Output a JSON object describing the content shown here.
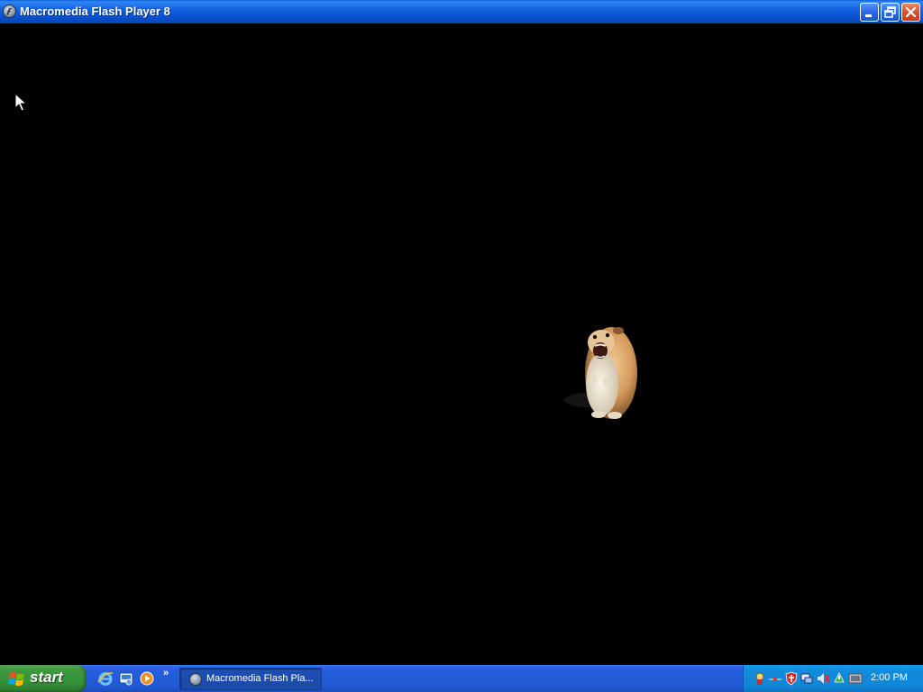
{
  "window": {
    "title": "Macromedia Flash Player 8",
    "icon": "flash-player-icon",
    "controls": [
      "minimize-icon",
      "restore-icon",
      "close-icon"
    ]
  },
  "stage": {
    "background": "#000000",
    "content": "hamster-image"
  },
  "taskbar": {
    "start_label": "start",
    "quick_launch": [
      "internet-explorer-icon",
      "show-desktop-icon",
      "media-player-icon"
    ],
    "more_label": "»",
    "tasks": [
      {
        "label": "Macromedia Flash Pla...",
        "icon": "flash-player-icon"
      }
    ],
    "tray_icons": [
      "security-icon",
      "network-icon",
      "shield-icon",
      "monitor-icon",
      "volume-icon",
      "update-icon",
      "display-icon"
    ],
    "clock": "2:00 PM"
  },
  "colors": {
    "titlebar": "#0a54d4",
    "close_button": "#d8512e",
    "taskbar": "#245edb",
    "start_button": "#37923a",
    "tray": "#1186d6"
  }
}
